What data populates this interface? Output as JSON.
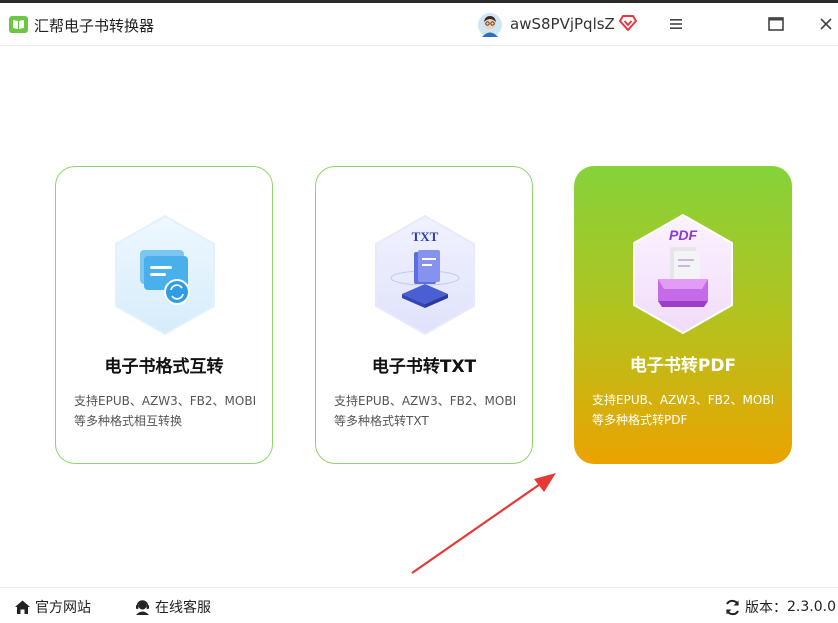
{
  "app": {
    "title": "汇帮电子书转换器"
  },
  "user": {
    "name": "awS8PVjPqlsZ"
  },
  "cards": [
    {
      "title": "电子书格式互转",
      "desc_line1": "支持EPUB、AZW3、FB2、MOBI",
      "desc_line2": "等多种格式相互转换"
    },
    {
      "title": "电子书转TXT",
      "desc_line1": "支持EPUB、AZW3、FB2、MOBI",
      "desc_line2": "等多种格式转TXT",
      "icon_text": "TXT"
    },
    {
      "title": "电子书转PDF",
      "desc_line1": "支持EPUB、AZW3、FB2、MOBI",
      "desc_line2": "等多种格式转PDF",
      "icon_text": "PDF"
    }
  ],
  "footer": {
    "site_label": "官方网站",
    "service_label": "在线客服",
    "version_label": "版本：",
    "version": "2.3.0.0"
  },
  "colors": {
    "card_border": "#8fd66a",
    "active_gradient_top": "#85d23a",
    "active_gradient_bottom": "#eba300",
    "vip": "#e8363f",
    "arrow": "#e53935"
  }
}
